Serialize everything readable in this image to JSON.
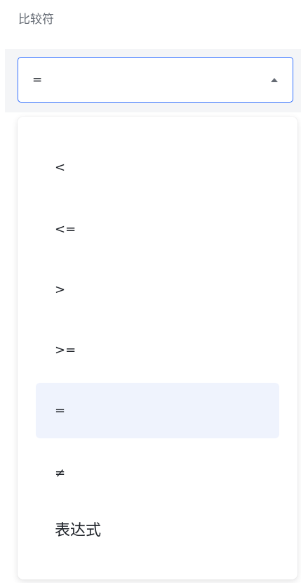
{
  "field": {
    "label": "比较符"
  },
  "select": {
    "value": "=",
    "caret_icon": "caret-up-icon",
    "accent_color": "#3370ff"
  },
  "dropdown": {
    "options": [
      {
        "label": "<"
      },
      {
        "label": "<="
      },
      {
        "label": ">"
      },
      {
        "label": ">="
      },
      {
        "label": "=",
        "selected": true
      },
      {
        "label": "≠"
      },
      {
        "label": "表达式"
      }
    ],
    "selected_bg_color": "#eff3fd"
  }
}
